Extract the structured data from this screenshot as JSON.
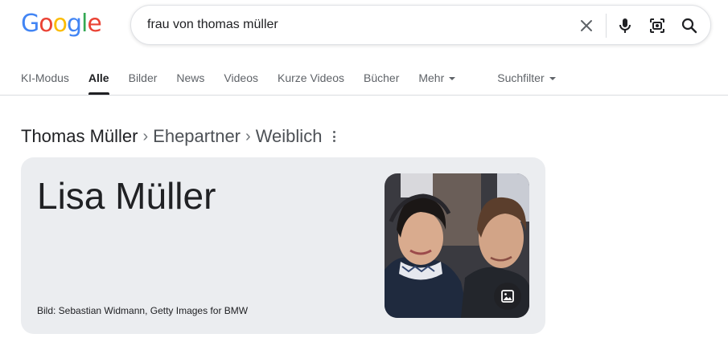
{
  "logo": {
    "text": "Google",
    "letters": [
      "G",
      "o",
      "o",
      "g",
      "l",
      "e"
    ],
    "colors": [
      "#4285F4",
      "#EA4335",
      "#FBBC05",
      "#4285F4",
      "#34A853",
      "#EA4335"
    ]
  },
  "search": {
    "query": "frau von thomas müller"
  },
  "icons": {
    "clear": "close-icon",
    "voice": "microphone-icon",
    "lens": "lens-camera-icon",
    "search": "search-icon"
  },
  "tabs": [
    {
      "label": "KI-Modus"
    },
    {
      "label": "Alle",
      "active": true
    },
    {
      "label": "Bilder"
    },
    {
      "label": "News"
    },
    {
      "label": "Videos"
    },
    {
      "label": "Kurze Videos"
    },
    {
      "label": "Bücher"
    },
    {
      "label": "Mehr",
      "dropdown": true
    },
    {
      "label": "Suchfilter",
      "dropdown": true
    }
  ],
  "breadcrumb": {
    "root": "Thomas Müller",
    "items": [
      "Ehepartner",
      "Weiblich"
    ]
  },
  "card": {
    "answer": "Lisa Müller",
    "image_credit": "Bild: Sebastian Widmann, Getty Images for BMW"
  },
  "colors": {
    "card_bg": "#ebedf0",
    "text_primary": "#202124",
    "text_secondary": "#5f6368",
    "divider": "#dadce0"
  }
}
